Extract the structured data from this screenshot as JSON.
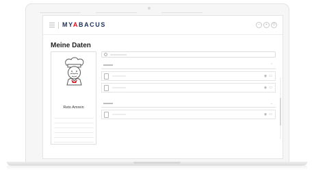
{
  "app": {
    "logo_prefix": "MY",
    "logo_accent": "A",
    "logo_suffix": "BACUS",
    "brand_color": "#1e2f56",
    "accent_color": "#e30613"
  },
  "topbar": {
    "icons": [
      "minus-circle-icon",
      "plus-circle-icon",
      "power-icon"
    ]
  },
  "page": {
    "title": "Meine Daten"
  },
  "profile": {
    "name": "Reto Amrein",
    "avatar": "chef-avatar-icon"
  },
  "search": {
    "icon": "search-icon"
  },
  "sections": [
    {
      "rows": 2
    },
    {
      "rows": 1
    }
  ]
}
